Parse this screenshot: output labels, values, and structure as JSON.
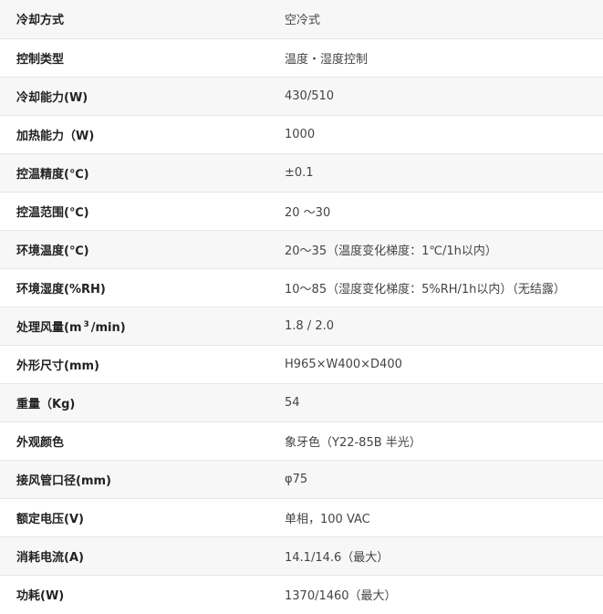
{
  "specs": [
    {
      "label": "冷却方式",
      "value": "空冷式"
    },
    {
      "label": "控制类型",
      "value": "温度・湿度控制"
    },
    {
      "label": "冷却能力(W)",
      "value": "430/510"
    },
    {
      "label": "加热能力（W)",
      "value": "1000"
    },
    {
      "label": "控温精度(℃)",
      "value": "±0.1"
    },
    {
      "label": "控温范围(℃)",
      "value": "20 ～30"
    },
    {
      "label": "环境温度(℃)",
      "value": "20～35（温度变化梯度：1℃/1h以内）"
    },
    {
      "label": "环境湿度(%RH)",
      "value": "10～85（湿度变化梯度：5%RH/1h以内）（无结露）"
    },
    {
      "label_pre": "处理风量(m",
      "label_sup": "3",
      "label_post": "/min)",
      "value": "1.8 / 2.0"
    },
    {
      "label": "外形尺寸(mm)",
      "value": "H965×W400×D400"
    },
    {
      "label": "重量（Kg)",
      "value": "54"
    },
    {
      "label": "外观颜色",
      "value": "象牙色（Y22-85B 半光）"
    },
    {
      "label": "接风管口径(mm)",
      "value": "φ75"
    },
    {
      "label": "额定电压(V)",
      "value": "单相，100 VAC"
    },
    {
      "label": "消耗电流(A)",
      "value": "14.1/14.6（最大）"
    },
    {
      "label": "功耗(W)",
      "value": "1370/1460（最大）"
    }
  ]
}
